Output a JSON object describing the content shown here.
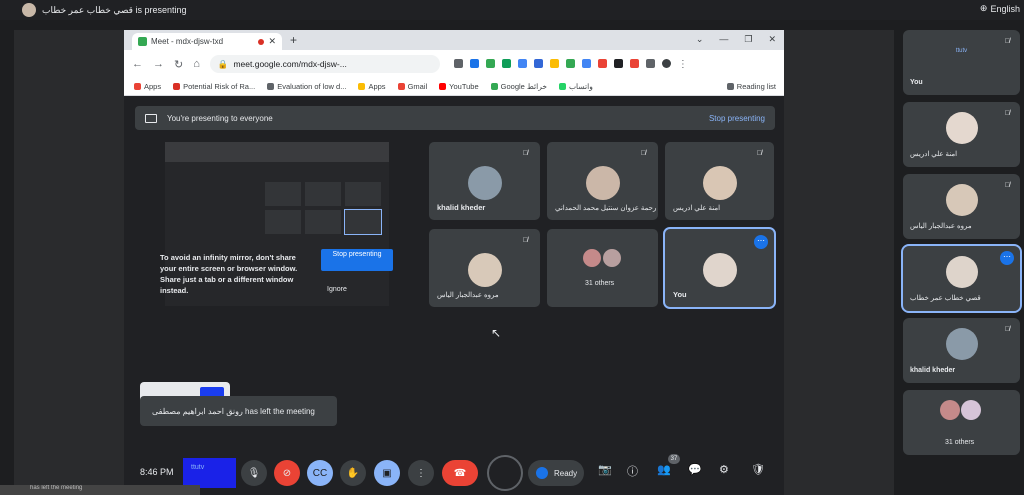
{
  "presenter_bar": {
    "text": "قصي خطاب عمر خطاب is presenting",
    "language": "English"
  },
  "browser": {
    "tab_title": "Meet - mdx-djsw-txd",
    "url": "meet.google.com/mdx-djsw-...",
    "bookmarks": [
      "Apps",
      "Potential Risk of Ra...",
      "Evaluation of low d...",
      "Apps",
      "Gmail",
      "YouTube",
      "Google خرائط",
      "واتساب"
    ],
    "reading_list": "Reading list"
  },
  "presenting_banner": {
    "text": "You're presenting to everyone",
    "stop_label": "Stop presenting"
  },
  "mirror_warning": {
    "text": "To avoid an infinity mirror, don't share your entire screen or browser window. Share just a tab or a different window instead.",
    "stop_label": "Stop presenting",
    "ignore_label": "Ignore"
  },
  "grid": [
    {
      "name": "khalid kheder",
      "bold": true
    },
    {
      "name": "رحمة عزوان سنتيل محمد الحمداني",
      "bold": false
    },
    {
      "name": "امنة علي ادريس",
      "bold": false
    },
    {
      "name": "مروه عبدالجبار الياس",
      "bold": false
    },
    {
      "name": "31 others",
      "bold": false
    },
    {
      "name": "You",
      "bold": true
    }
  ],
  "toast": {
    "text": "رونق احمد ابراهيم مصطفى has left the meeting"
  },
  "controls": {
    "time": "8:46 PM",
    "self_preview_label": "ttutv",
    "ready_label": "Ready",
    "participants_count": "37"
  },
  "bottom_strip": {
    "text": "has left the meeting"
  },
  "sidebar": [
    {
      "name": "You",
      "self_label": "ttutv"
    },
    {
      "name": "امنة علي ادريس"
    },
    {
      "name": "مروه عبدالجبار الياس"
    },
    {
      "name": "قصي خطاب عمر خطاب"
    },
    {
      "name": "khalid kheder"
    },
    {
      "name": "31 others"
    }
  ],
  "colors": {
    "accent": "#1a73e8",
    "end_call": "#ea4335",
    "tile": "#3c4043",
    "background": "#202124"
  }
}
